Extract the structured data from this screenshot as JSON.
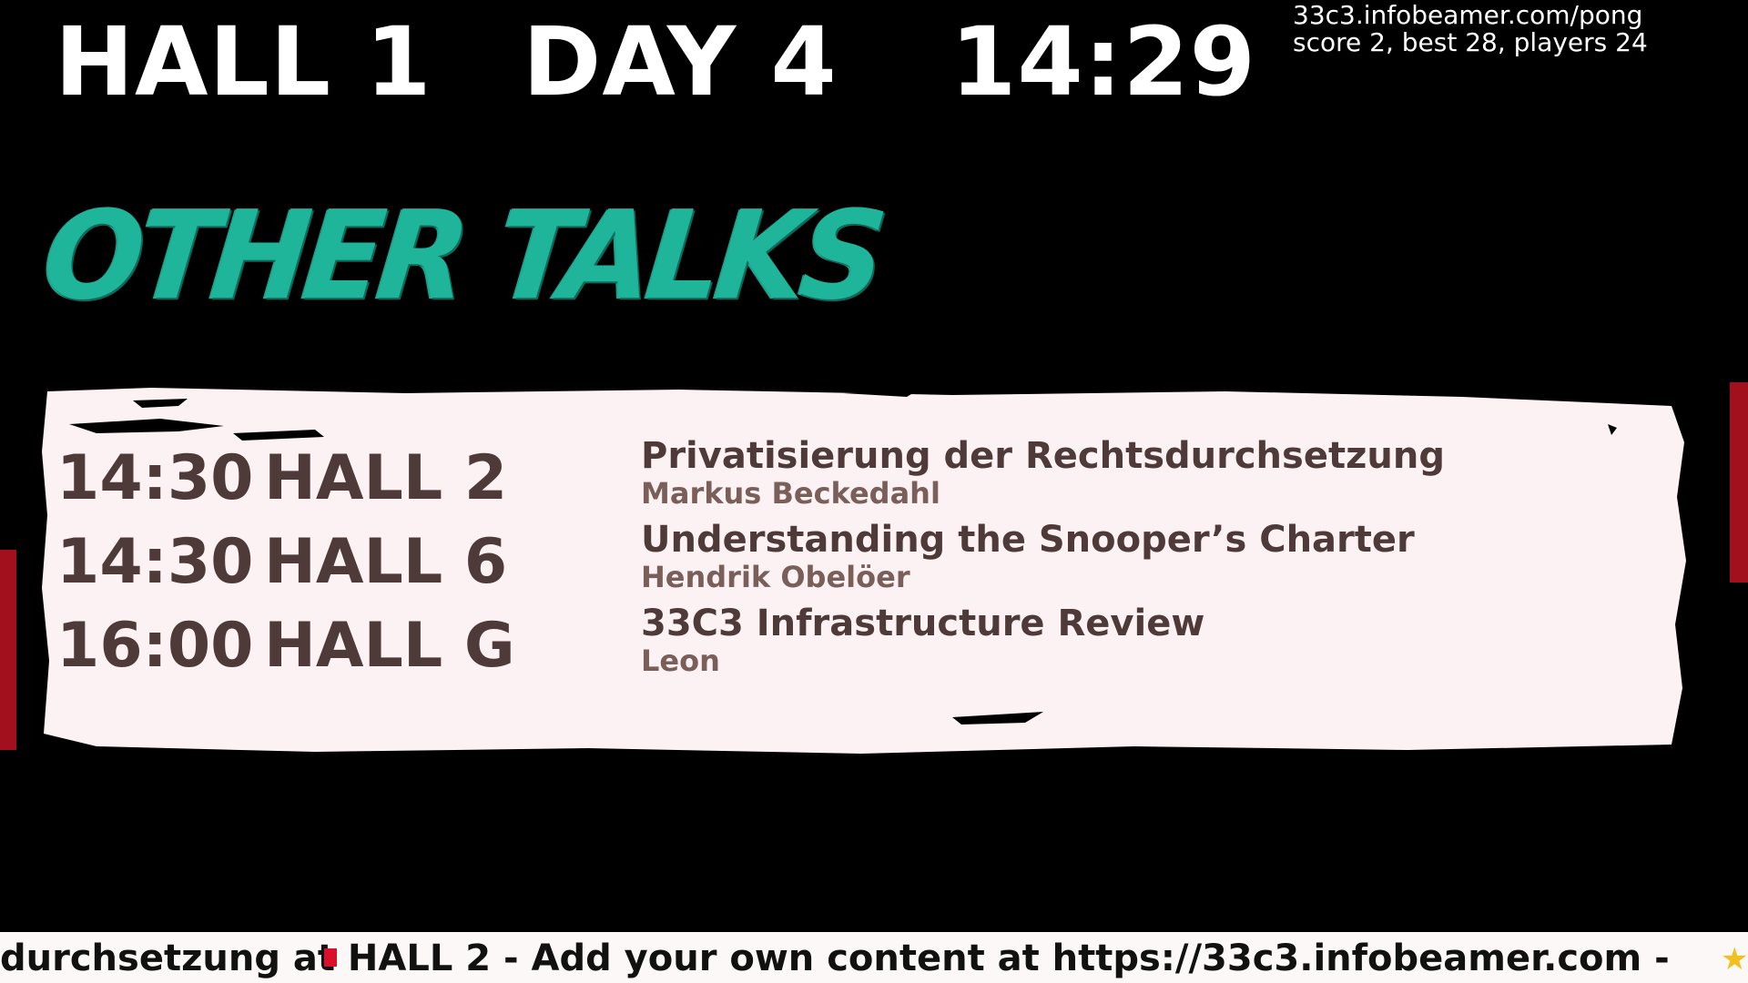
{
  "header": {
    "hall": "HALL 1",
    "day": "DAY 4",
    "time": "14:29"
  },
  "info": {
    "url": "33c3.infobeamer.com/pong",
    "stats": "score 2, best 28, players 24"
  },
  "section_title": "OTHER TALKS",
  "talks": [
    {
      "time": "14:30",
      "hall": "HALL 2",
      "title": "Privatisierung der Rechtsdurchsetzung",
      "speaker": "Markus Beckedahl"
    },
    {
      "time": "14:30",
      "hall": "HALL 6",
      "title": "Understanding the Snooper’s Charter",
      "speaker": "Hendrik Obelöer"
    },
    {
      "time": "16:00",
      "hall": "HALL G",
      "title": "33C3 Infrastructure Review",
      "speaker": "Leon"
    }
  ],
  "ticker": {
    "text": "durchsetzung at HALL 2    -    Add your own content at https://33c3.infobeamer.com    -"
  },
  "colors": {
    "background": "#000000",
    "title_accent": "#1fb59a",
    "panel": "#fdf2f3",
    "talk_text": "#4e3a38",
    "side_bars": "#a2101e",
    "ticker_background": "#fdf8f8"
  },
  "icons": {
    "ticker_marker": "red-square",
    "ticker_star": "star-icon"
  }
}
